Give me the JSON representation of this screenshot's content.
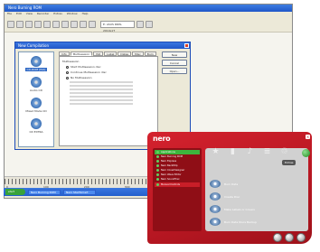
{
  "app": {
    "title": "Nero Burning ROM",
    "menu": [
      "File",
      "Edit",
      "View",
      "Recorder",
      "Extras",
      "Window",
      "Help"
    ],
    "drive_combo": "E: ASUS DRW-2014L1T"
  },
  "dialog": {
    "title": "New Compilation",
    "tabs": [
      "Info",
      "Multisession",
      "ISO",
      "Label",
      "Dates",
      "Misc",
      "Burn"
    ],
    "recorders": [
      {
        "label": "CD-ROM (ISO)",
        "selected": true
      },
      {
        "label": "Audio CD",
        "selected": false
      },
      {
        "label": "Mixed Mode CD",
        "selected": false
      },
      {
        "label": "CD EXTRA",
        "selected": false
      }
    ],
    "panel_heading": "Multisession",
    "options": [
      {
        "label": "Start Multisession disc",
        "selected": false
      },
      {
        "label": "Continue Multisession disc",
        "selected": false
      },
      {
        "label": "No Multisession",
        "selected": true
      }
    ],
    "buttons": [
      "New",
      "Cancel",
      "Open..."
    ]
  },
  "ruler": {
    "labels": [
      "0",
      "100",
      "200",
      "300",
      "400",
      "500",
      "600",
      "700"
    ]
  },
  "taskbar": {
    "start": "start",
    "items": [
      "Nero Burning ROM",
      "Nero StartSmart"
    ]
  },
  "nero": {
    "logo": "nero",
    "menu_items": [
      {
        "label": "Applications",
        "highlight": true
      },
      {
        "label": "Nero Burning ROM",
        "highlight": false
      },
      {
        "label": "Nero Express",
        "highlight": false
      },
      {
        "label": "Nero BackItUp",
        "highlight": false
      },
      {
        "label": "Nero CoverDesigner",
        "highlight": false
      },
      {
        "label": "Nero Wave Editor",
        "highlight": false
      },
      {
        "label": "Nero SoundTrax",
        "highlight": false
      }
    ],
    "category_item": "Manual Controls",
    "extras_label": "Extras",
    "tasks": [
      "Burn Data",
      "Create Disc",
      "Make Labels or Covers",
      "Burn Data Discs Backup"
    ]
  }
}
